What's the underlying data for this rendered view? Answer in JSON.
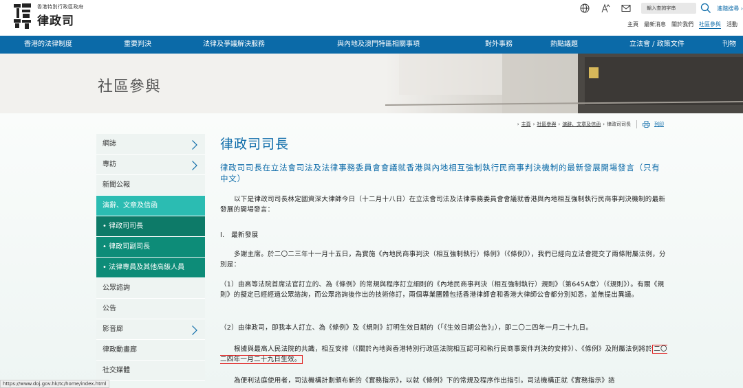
{
  "header": {
    "logo_sub": "香港特別行政區政府",
    "logo_main": "律政司",
    "search_placeholder": "輸入查詢字串",
    "advanced_search": "進階搜尋 ›",
    "top_links": [
      "主頁",
      "最新消息",
      "關於我們",
      "社區參與",
      "活動"
    ],
    "active_top_link": "社區參與"
  },
  "nav": {
    "items": [
      "香港的法律制度",
      "重要判決",
      "法律及爭議解決服務",
      "與內地及澳門特區相關事項",
      "對外事務",
      "熱點議題",
      "立法會 / 政策文件",
      "刊物"
    ]
  },
  "banner": {
    "title": "社區參與"
  },
  "breadcrumb": {
    "items": [
      "主頁",
      "社區參與",
      "演辭、文章及信函",
      "律政司司長"
    ],
    "print_label": "列印"
  },
  "sidebar": {
    "items": [
      {
        "label": "網誌",
        "has_chevron": true,
        "state": "normal"
      },
      {
        "label": "專訪",
        "has_chevron": true,
        "state": "normal"
      },
      {
        "label": "新聞公報",
        "has_chevron": false,
        "state": "normal"
      },
      {
        "label": "演辭、文章及信函",
        "has_chevron": false,
        "state": "active-parent"
      },
      {
        "label": "• 律政司司長",
        "has_chevron": false,
        "state": "active"
      },
      {
        "label": "• 律政司副司長",
        "has_chevron": false,
        "state": "sub"
      },
      {
        "label": "• 法律專員及其他高級人員",
        "has_chevron": false,
        "state": "sub"
      },
      {
        "label": "公眾諮詢",
        "has_chevron": false,
        "state": "normal"
      },
      {
        "label": "公告",
        "has_chevron": false,
        "state": "normal"
      },
      {
        "label": "影音廊",
        "has_chevron": true,
        "state": "normal"
      },
      {
        "label": "律政動畫廊",
        "has_chevron": false,
        "state": "normal"
      },
      {
        "label": "社交媒體",
        "has_chevron": false,
        "state": "normal"
      }
    ]
  },
  "article": {
    "title": "律政司司長",
    "subtitle": "律政司司長在立法會司法及法律事務委員會會議就香港與內地相互強制執行民商事判決機制的最新發展開場發言（只有中文）",
    "p1": "以下是律政司司長林定國資深大律師今日（十二月十八日）在立法會司法及法律事務委員會會議就香港與內地相互強制執行民商事判決機制的最新發展的開場發言：",
    "p2": "I.　最新發展",
    "p3": "多謝主席。於二〇二三年十一月十五日，為實施《內地民商事判決（相互強制執行）條例》（《條例》），我們已經向立法會提交了兩條附屬法例，分別是：",
    "p4": "（1）由高等法院首席法官訂立的、為《條例》的常規與程序訂立細則的《內地民商事判決（相互強制執行）規則》（第645A章）（《規則》）。有關《規則》的擬定已經經過公眾諮詢，而公眾諮詢後作出的技術修訂，兩個專業團體包括香港律師會和香港大律師公會都分別知悉，並無提出異議。",
    "p5": "（2）由律政司，即我本人訂立、為《條例》及《規則》訂明生效日期的（「《生效日期公告》」），即二〇二四年一月二十九日。",
    "p6_before": "根據與最高人民法院的共識，相互安排（《關於內地與香港特別行政區法院相互認可和執行民商事案件判決的安排》）、《條例》及附屬法例將於",
    "p6_highlight": "二〇二四年一月二十九日生效。",
    "p7": "為便利法庭使用者，司法機構計劃頒布新的《實務指示》，以就《條例》下的常規及程序作出指引。司法機構正就《實務指示》諮"
  },
  "status": {
    "url": "https://www.doj.gov.hk/tc/home/index.html"
  },
  "colors": {
    "brand_blue": "#0b6aa8",
    "sidebar_teal": "#2bbcb2",
    "sidebar_dark": "#0d7a68",
    "highlight_red": "#e02020"
  }
}
